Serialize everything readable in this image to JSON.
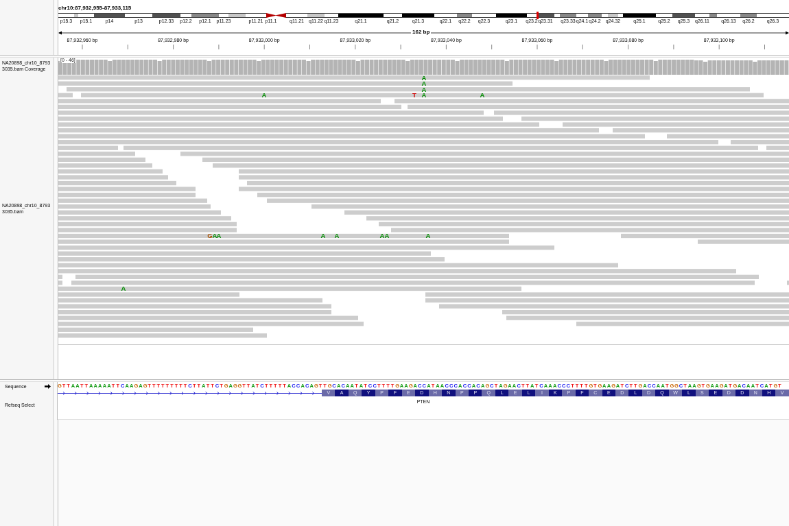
{
  "locus": "chr10:87,932,955-87,933,115",
  "ideogram": {
    "bands": [
      {
        "label": "p15.3",
        "kind": "band",
        "color": "#ffffff"
      },
      {
        "kind": "band",
        "color": "#c8c8c8"
      },
      {
        "label": "p15.1",
        "kind": "band",
        "color": "#ffffff"
      },
      {
        "label": "p14",
        "kind": "band",
        "color": "#505050"
      },
      {
        "label": "p13",
        "kind": "band",
        "color": "#ffffff"
      },
      {
        "label": "p12.33",
        "kind": "band",
        "color": "#505050"
      },
      {
        "label": "p12.2",
        "kind": "band",
        "color": "#ffffff"
      },
      {
        "label": "p12.1",
        "kind": "band",
        "color": "#888888"
      },
      {
        "label": "p11.23",
        "kind": "band",
        "color": "#ffffff"
      },
      {
        "kind": "band",
        "color": "#c8c8c8"
      },
      {
        "label": "p11.21",
        "kind": "band",
        "color": "#ffffff"
      },
      {
        "label": "p11.1",
        "kind": "centromere_p",
        "color": "#b40000"
      },
      {
        "kind": "centromere_q",
        "color": "#b40000"
      },
      {
        "label": "q11.21",
        "kind": "band",
        "color": "#ffffff"
      },
      {
        "label": "q11.22",
        "kind": "band",
        "color": "#c8c8c8"
      },
      {
        "label": "q11.23",
        "kind": "band",
        "color": "#ffffff"
      },
      {
        "label": "q21.1",
        "kind": "band",
        "color": "#000000"
      },
      {
        "label": "q21.2",
        "kind": "band",
        "color": "#ffffff"
      },
      {
        "label": "q21.3",
        "kind": "band",
        "color": "#000000"
      },
      {
        "label": "q22.1",
        "kind": "band",
        "color": "#ffffff"
      },
      {
        "label": "q22.2",
        "kind": "band",
        "color": "#888888"
      },
      {
        "label": "q22.3",
        "kind": "band",
        "color": "#ffffff"
      },
      {
        "label": "q23.1",
        "kind": "band",
        "color": "#000000"
      },
      {
        "label": "q23.2",
        "kind": "band",
        "color": "#ffffff"
      },
      {
        "label": "q23.31",
        "kind": "band",
        "color": "#505050"
      },
      {
        "kind": "band",
        "color": "#ffffff"
      },
      {
        "label": "q23.33",
        "kind": "band",
        "color": "#888888"
      },
      {
        "label": "q24.1",
        "kind": "band",
        "color": "#ffffff"
      },
      {
        "label": "q24.2",
        "kind": "band",
        "color": "#888888"
      },
      {
        "kind": "band",
        "color": "#ffffff"
      },
      {
        "label": "q24.32",
        "kind": "band",
        "color": "#c8c8c8"
      },
      {
        "kind": "band",
        "color": "#ffffff"
      },
      {
        "label": "q25.1",
        "kind": "band",
        "color": "#000000"
      },
      {
        "label": "q25.2",
        "kind": "band",
        "color": "#ffffff"
      },
      {
        "label": "q25.3",
        "kind": "band",
        "color": "#505050"
      },
      {
        "label": "q26.11",
        "kind": "band",
        "color": "#ffffff"
      },
      {
        "kind": "band",
        "color": "#888888"
      },
      {
        "label": "q26.13",
        "kind": "band",
        "color": "#ffffff"
      },
      {
        "label": "q26.2",
        "kind": "band",
        "color": "#888888"
      },
      {
        "label": "q26.3",
        "kind": "band",
        "color": "#ffffff"
      }
    ]
  },
  "ruler": {
    "span": "162 bp",
    "ticks": [
      "87,932,960 bp",
      "87,932,980 bp",
      "87,933,000 bp",
      "87,933,020 bp",
      "87,933,040 bp",
      "87,933,060 bp",
      "87,933,080 bp",
      "87,933,100 bp"
    ]
  },
  "tracks": {
    "coverage_name": "NA20898_chr10_87933035.bam Coverage",
    "coverage_range": "[0 - 46]",
    "alignment_name": "NA20898_chr10_87933035.bam",
    "sequence_name": "Sequence",
    "gene_track_name": "Refseq Select"
  },
  "mismatches": [
    {
      "base": "A",
      "color": "#008c00"
    },
    {
      "base": "A",
      "color": "#008c00"
    },
    {
      "base": "A",
      "color": "#008c00"
    },
    {
      "base": "A",
      "color": "#008c00"
    },
    {
      "base": "T",
      "color": "#d00000"
    },
    {
      "base": "A",
      "color": "#008c00"
    },
    {
      "base": "A",
      "color": "#008c00"
    },
    {
      "base": "G",
      "color": "#a85000"
    },
    {
      "base": "A",
      "color": "#008c00"
    },
    {
      "base": "A",
      "color": "#008c00"
    },
    {
      "base": "A",
      "color": "#008c00"
    },
    {
      "base": "A",
      "color": "#008c00"
    },
    {
      "base": "A",
      "color": "#008c00"
    },
    {
      "base": "A",
      "color": "#008c00"
    },
    {
      "base": "A",
      "color": "#008c00"
    },
    {
      "base": "A",
      "color": "#008c00"
    }
  ],
  "sequence": [
    "G",
    "T",
    "T",
    "A",
    "A",
    "T",
    "T",
    "A",
    "A",
    "A",
    "A",
    "A",
    "T",
    "T",
    "C",
    "A",
    "A",
    "G",
    "A",
    "G",
    "T",
    "T",
    "T",
    "T",
    "T",
    "T",
    "T",
    "T",
    "T",
    "C",
    "T",
    "T",
    "A",
    "T",
    "T",
    "C",
    "T",
    "G",
    "A",
    "G",
    "G",
    "T",
    "T",
    "A",
    "T",
    "C",
    "T",
    "T",
    "T",
    "T",
    "T",
    "A",
    "C",
    "C",
    "A",
    "C",
    "A",
    "G",
    "T",
    "T",
    "G",
    "C",
    "A",
    "C",
    "A",
    "A",
    "T",
    "A",
    "T",
    "C",
    "C",
    "T",
    "T",
    "T",
    "T",
    "G",
    "A",
    "A",
    "G",
    "A",
    "C",
    "C",
    "A",
    "T",
    "A",
    "A",
    "C",
    "C",
    "C",
    "A",
    "C",
    "C",
    "A",
    "C",
    "A",
    "G",
    "C",
    "T",
    "A",
    "G",
    "A",
    "A",
    "C",
    "T",
    "T",
    "A",
    "T",
    "C",
    "A",
    "A",
    "A",
    "C",
    "C",
    "C",
    "T",
    "T",
    "T",
    "T",
    "G",
    "T",
    "G",
    "A",
    "A",
    "G",
    "A",
    "T",
    "C",
    "T",
    "T",
    "G",
    "A",
    "C",
    "C",
    "A",
    "A",
    "T",
    "G",
    "G",
    "C",
    "T",
    "A",
    "A",
    "G",
    "T",
    "G",
    "A",
    "A",
    "G",
    "A",
    "T",
    "G",
    "A",
    "C",
    "A",
    "A",
    "T",
    "C",
    "A",
    "T",
    "G",
    "T"
  ],
  "gene": {
    "name": "PTEN",
    "amino_acids": "V A Q Y P F E D H N P P Q L E L I K P F C E D L D Q W L S E D D N H V"
  }
}
